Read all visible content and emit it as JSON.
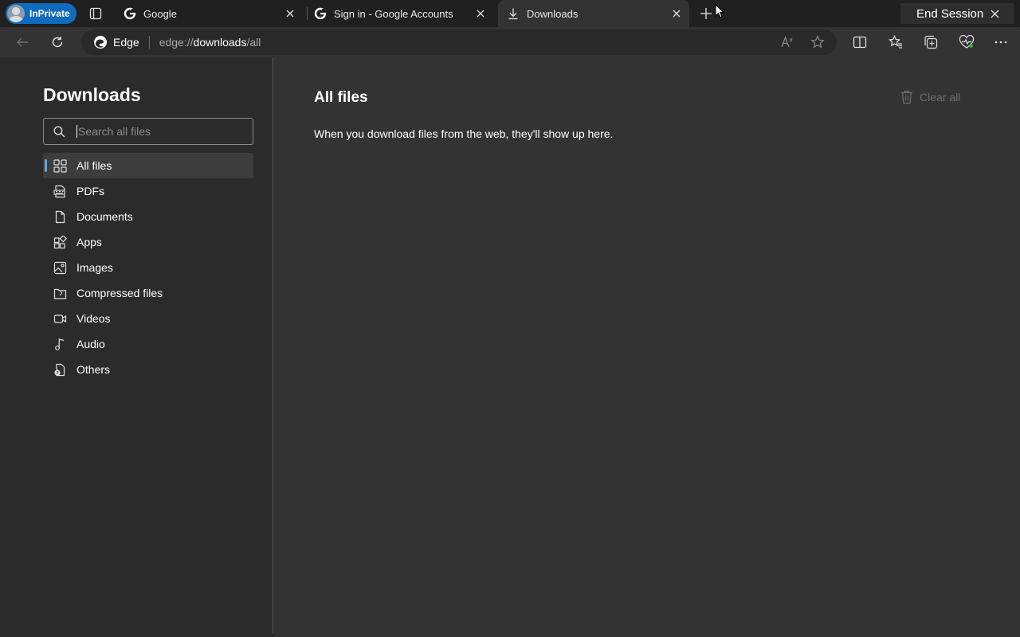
{
  "window": {
    "inprivate_label": "InPrivate",
    "end_session_label": "End Session",
    "tabs": [
      {
        "title": "Google",
        "icon": "google-g-icon"
      },
      {
        "title": "Sign in - Google Accounts",
        "icon": "google-g-icon"
      },
      {
        "title": "Downloads",
        "icon": "download-icon",
        "active": true
      }
    ]
  },
  "toolbar": {
    "site_label": "Edge",
    "url_prefix": "edge://",
    "url_host": "downloads",
    "url_path": "/all"
  },
  "sidebar": {
    "title": "Downloads",
    "search_placeholder": "Search all files",
    "items": [
      {
        "label": "All files",
        "icon": "grid-icon",
        "selected": true
      },
      {
        "label": "PDFs",
        "icon": "pdf-icon"
      },
      {
        "label": "Documents",
        "icon": "document-icon"
      },
      {
        "label": "Apps",
        "icon": "apps-icon"
      },
      {
        "label": "Images",
        "icon": "image-icon"
      },
      {
        "label": "Compressed files",
        "icon": "zip-icon"
      },
      {
        "label": "Videos",
        "icon": "video-icon"
      },
      {
        "label": "Audio",
        "icon": "music-note-icon"
      },
      {
        "label": "Others",
        "icon": "file-question-icon"
      }
    ]
  },
  "main": {
    "title": "All files",
    "empty_message": "When you download files from the web, they'll show up here.",
    "clear_all_label": "Clear all"
  },
  "colors": {
    "accent": "#0f6cbd",
    "selection_indicator": "#60a5e8",
    "page_bg": "#333333",
    "sidebar_bg": "#2b2b2b"
  }
}
